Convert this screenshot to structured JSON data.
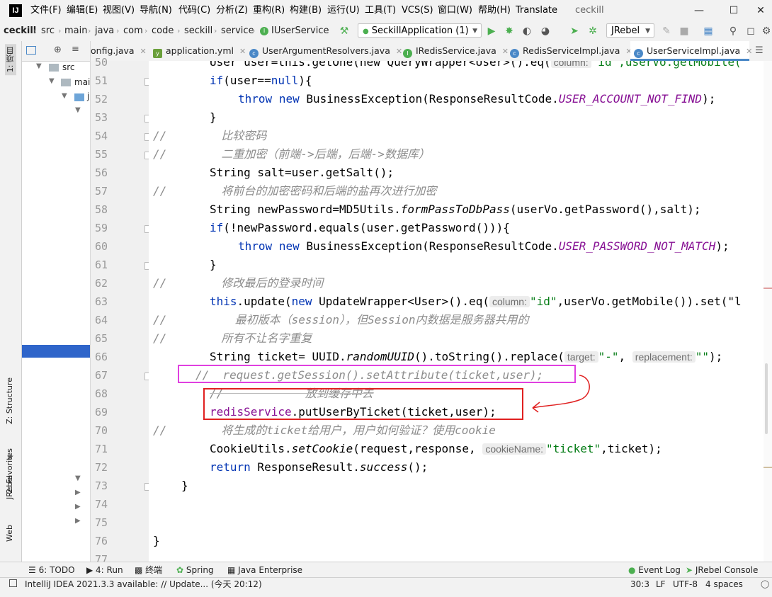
{
  "app": {
    "window_title": "ceckill"
  },
  "menu": [
    "文件(F)",
    "编辑(E)",
    "视图(V)",
    "导航(N)",
    "代码(C)",
    "分析(Z)",
    "重构(R)",
    "构建(B)",
    "运行(U)",
    "工具(T)",
    "VCS(S)",
    "窗口(W)",
    "帮助(H)",
    "Translate"
  ],
  "breadcrumb": [
    "ceckill",
    "src",
    "main",
    "java",
    "com",
    "code",
    "seckill",
    "service",
    "IUserService"
  ],
  "toolbar": {
    "run_config": "SeckillApplication (1)",
    "jrebel": "JRebel"
  },
  "left_stripe": {
    "project": "1: 项目",
    "structure": "Z: Structure",
    "favorites": "2: Favorites",
    "jrebel": "JRebel",
    "web": "Web"
  },
  "project_tree": {
    "src": "src",
    "main": "mai",
    "java": "j"
  },
  "tabs": [
    "onfig.java",
    "application.yml",
    "UserArgumentResolvers.java",
    "IRedisService.java",
    "RedisServiceImpl.java",
    "UserServiceImpl.java"
  ],
  "active_tab": 5,
  "line_numbers": [
    "50",
    "51",
    "52",
    "53",
    "54",
    "55",
    "56",
    "57",
    "58",
    "59",
    "60",
    "61",
    "62",
    "63",
    "64",
    "65",
    "66",
    "67",
    "68",
    "69",
    "70",
    "71",
    "72",
    "73",
    "74",
    "75",
    "76",
    "77"
  ],
  "code": {
    "l50_a": "User user=this.getOne(new QueryWrapper<User>().eq(",
    "l50_hint": "column:",
    "l50_b": "\"id\",userVo.getMobile(",
    "l51_kw": "if",
    "l51_a": "(user==",
    "l51_null": "null",
    "l51_b": "){",
    "l52_throw": "throw",
    "l52_new": "new",
    "l52_a": " BusinessException(ResponseResultCode.",
    "l52_const": "USER_ACCOUNT_NOT_FIND",
    "l52_b": ");",
    "l53": "}",
    "l54": "//        比较密码",
    "l55": "//        二重加密（前端->后端，后端->数据库）",
    "l56": "String salt=user.getSalt();",
    "l57": "//        将前台的加密密码和后端的盐再次进行加密",
    "l58_a": "String newPassword=MD5Utils.",
    "l58_m": "formPassToDbPass",
    "l58_b": "(userVo.getPassword(),salt);",
    "l59_kw": "if",
    "l59_a": "(!newPassword.equals(user.getPassword())){",
    "l60_throw": "throw",
    "l60_new": "new",
    "l60_a": " BusinessException(ResponseResultCode.",
    "l60_const": "USER_PASSWORD_NOT_MATCH",
    "l60_b": ");",
    "l61": "}",
    "l62": "//        修改最后的登录时间",
    "l63_this": "this",
    "l63_a": ".update(",
    "l63_new": "new",
    "l63_b": " UpdateWrapper<User>().eq(",
    "l63_hint": "column:",
    "l63_str": "\"id\"",
    "l63_c": ",userVo.getMobile()).set(\"l",
    "l64": "//          最初版本（session），但Session内数据是服务器共用的",
    "l65": "//        所有不让名字重复",
    "l66_a": "String ticket= UUID.",
    "l66_m": "randomUUID",
    "l66_b": "().toString().replace(",
    "l66_hint1": "target:",
    "l66_s1": "\"-\"",
    "l66_c": ",",
    "l66_hint2": "replacement:",
    "l66_s2": "\"\"",
    "l66_d": ");",
    "l67": "//  request.getSession().setAttribute(ticket,user);",
    "l68": "//            放到缓存中去",
    "l69_field": "redisService",
    "l69_a": ".putUserByTicket(ticket,user);",
    "l70": "//        将生成的ticket给用户，用户如何验证？使用cookie",
    "l71_a": "CookieUtils.",
    "l71_m": "setCookie",
    "l71_b": "(request,response,",
    "l71_hint": "cookieName:",
    "l71_str": "\"ticket\"",
    "l71_c": ",ticket);",
    "l72_kw": "return",
    "l72_a": " ResponseResult.",
    "l72_m": "success",
    "l72_b": "();",
    "l73": "}",
    "l76": "}"
  },
  "bottom_tools": [
    "6: TODO",
    "4: Run",
    "终端",
    "Spring",
    "Java Enterprise",
    "Event Log",
    "JRebel Console"
  ],
  "status": {
    "message": "IntelliJ IDEA 2021.3.3 available: // Update... (今天 20:12)",
    "position": "30:3",
    "line_sep": "LF",
    "encoding": "UTF-8",
    "indent": "4 spaces"
  },
  "colors": {
    "keyword": "#0033b3",
    "constant": "#871094",
    "comment": "#8c8c8c",
    "string": "#067d17",
    "annotation_magenta": "#e040e0",
    "annotation_red": "#e02020"
  }
}
